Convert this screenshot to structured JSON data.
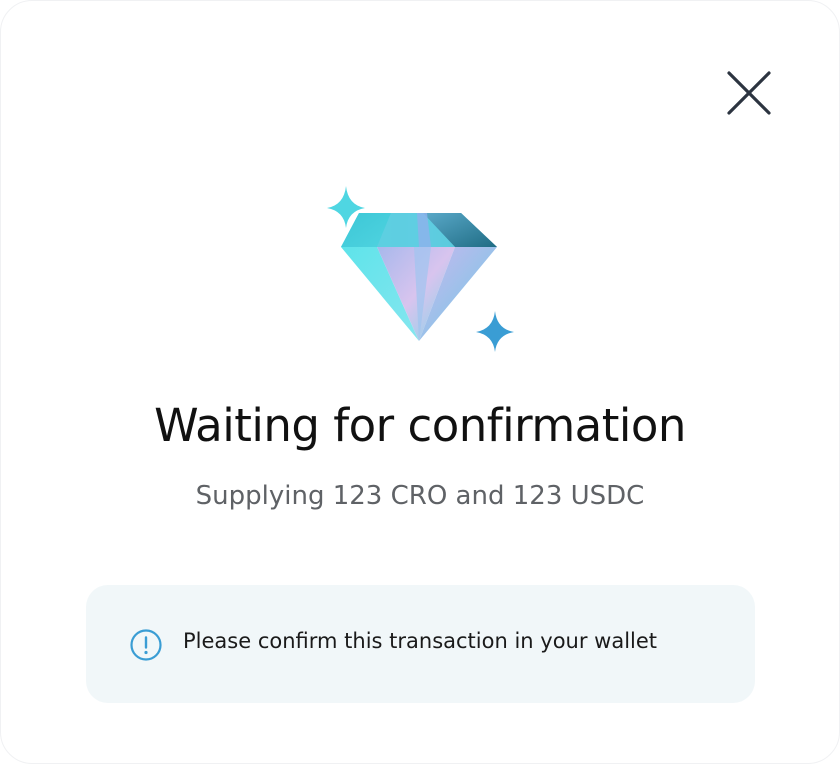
{
  "dialog": {
    "close_icon": "close-icon",
    "illustration_icon": "diamond-icon",
    "title": "Waiting for confirmation",
    "subtitle": "Supplying 123 CRO and 123 USDC",
    "notice": {
      "icon": "info-icon",
      "text": "Please confirm this transaction in your wallet"
    }
  },
  "colors": {
    "accent_cyan": "#4fd3e0",
    "accent_blue": "#3a9dd4",
    "notice_bg": "#f1f7f9",
    "text_primary": "#111111",
    "text_secondary": "#5f6266"
  }
}
